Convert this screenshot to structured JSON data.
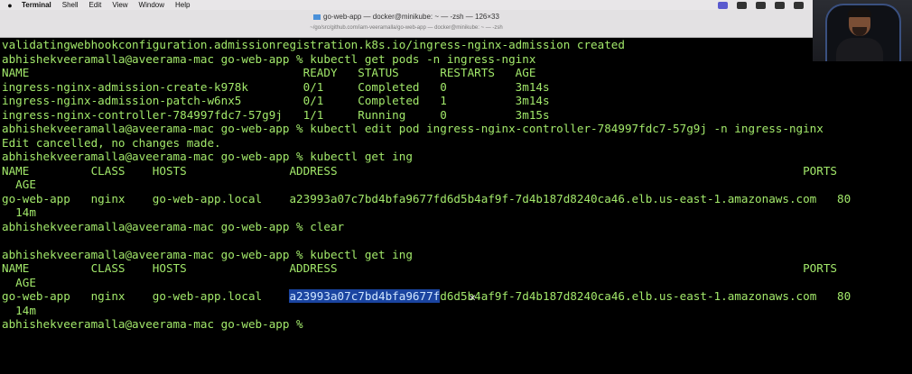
{
  "menubar": {
    "apple": "",
    "items": [
      "Terminal",
      "Shell",
      "Edit",
      "View",
      "Window",
      "Help"
    ]
  },
  "window": {
    "title": "go-web-app — docker@minikube: ~ — -zsh — 126×33",
    "subtitle": "~/go/src/github.com/iam-veeramalla/go-web-app — docker@minikube: ~ — -zsh"
  },
  "terminal": {
    "lines": [
      "validatingwebhookconfiguration.admissionregistration.k8s.io/ingress-nginx-admission created",
      "abhishekveeramalla@aveerama-mac go-web-app % kubectl get pods -n ingress-nginx",
      "NAME                                        READY   STATUS      RESTARTS   AGE",
      "ingress-nginx-admission-create-k978k        0/1     Completed   0          3m14s",
      "ingress-nginx-admission-patch-w6nx5         0/1     Completed   1          3m14s",
      "ingress-nginx-controller-784997fdc7-57g9j   1/1     Running     0          3m15s",
      "abhishekveeramalla@aveerama-mac go-web-app % kubectl edit pod ingress-nginx-controller-784997fdc7-57g9j -n ingress-nginx",
      "Edit cancelled, no changes made.",
      "abhishekveeramalla@aveerama-mac go-web-app % kubectl get ing",
      "NAME         CLASS    HOSTS               ADDRESS                                                                    PORTS",
      "  AGE",
      "go-web-app   nginx    go-web-app.local    a23993a07c7bd4bfa9677fd6d5b4af9f-7d4b187d8240ca46.elb.us-east-1.amazonaws.com   80",
      "  14m",
      "abhishekveeramalla@aveerama-mac go-web-app % clear",
      "",
      "abhishekveeramalla@aveerama-mac go-web-app % kubectl get ing",
      "NAME         CLASS    HOSTS               ADDRESS                                                                    PORTS",
      "  AGE"
    ],
    "final_row": {
      "prefix": "go-web-app   nginx    go-web-app.local    ",
      "selected": "a23993a07c7bd4bfa9677f",
      "suffix": "d6d5b4af9f-7d4b187d8240ca46.elb.us-east-1.amazonaws.com   80"
    },
    "after": [
      "  14m",
      "abhishekveeramalla@aveerama-mac go-web-app % "
    ]
  },
  "colors": {
    "terminal_bg": "#000000",
    "terminal_fg": "#a2e86a",
    "selection": "#1a44a0"
  }
}
